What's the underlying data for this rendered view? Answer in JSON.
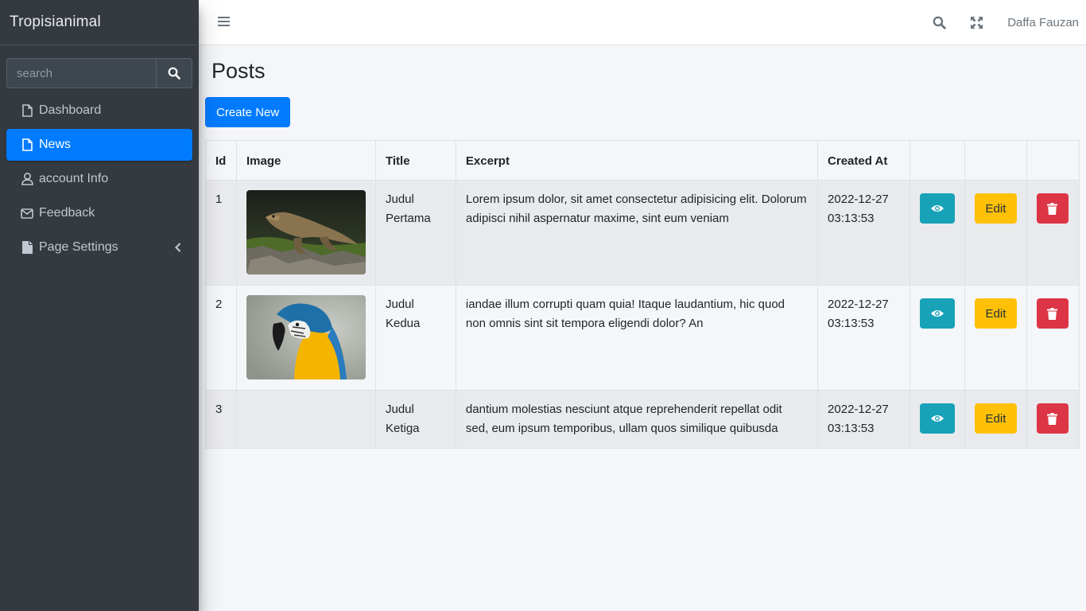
{
  "brand": "Tropisianimal",
  "search": {
    "placeholder": "search"
  },
  "sidebar": {
    "items": [
      {
        "label": "Dashboard",
        "icon": "file-icon"
      },
      {
        "label": "News",
        "icon": "file-icon",
        "active": true
      },
      {
        "label": "account Info",
        "icon": "user-icon"
      },
      {
        "label": "Feedback",
        "icon": "envelope-icon"
      },
      {
        "label": "Page Settings",
        "icon": "file-solid-icon",
        "chevron": "chevron-left-icon"
      }
    ]
  },
  "navbar": {
    "user": "Daffa Fauzan",
    "icons": [
      "menu-icon",
      "search-icon",
      "expand-icon"
    ]
  },
  "page": {
    "title": "Posts",
    "create_label": "Create New"
  },
  "table": {
    "columns": [
      "Id",
      "Image",
      "Title",
      "Excerpt",
      "Created At",
      "",
      "",
      ""
    ],
    "rows": [
      {
        "id": "1",
        "image": "komodo-dragon-photo",
        "title": "Judul Pertama",
        "excerpt": "Lorem ipsum dolor, sit amet consectetur adipisicing elit. Dolorum adipisci nihil aspernatur maxime, sint eum veniam",
        "created_at": "2022-12-27 03:13:53"
      },
      {
        "id": "2",
        "image": "macaw-parrot-photo",
        "title": "Judul Kedua",
        "excerpt": "iandae illum corrupti quam quia! Itaque laudantium, hic quod non omnis sint sit tempora eligendi dolor? An",
        "created_at": "2022-12-27 03:13:53"
      },
      {
        "id": "3",
        "image": "",
        "title": "Judul Ketiga",
        "excerpt": "dantium molestias nesciunt atque reprehenderit repellat odit sed, eum ipsum temporibus, ullam quos similique quibusda",
        "created_at": "2022-12-27 03:13:53"
      }
    ],
    "actions": {
      "view_icon": "eye-icon",
      "edit_label": "Edit",
      "delete_icon": "trash-icon"
    }
  },
  "colors": {
    "sidebar": "#343a40",
    "primary": "#007bff",
    "info": "#17a2b8",
    "warning": "#ffc107",
    "danger": "#dc3545"
  }
}
